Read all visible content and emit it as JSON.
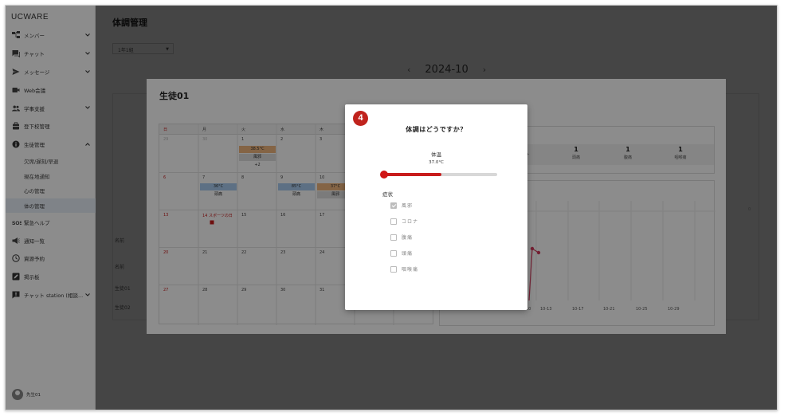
{
  "app": {
    "brand": "UCWARE"
  },
  "sidebar": {
    "items": [
      {
        "label": "メンバー",
        "icon": "org-chart-icon",
        "has_chevron": true
      },
      {
        "label": "チャット",
        "icon": "chat-icon",
        "has_chevron": true
      },
      {
        "label": "メッセージ",
        "icon": "send-icon",
        "has_chevron": true
      },
      {
        "label": "Web会議",
        "icon": "video-icon",
        "has_chevron": false
      },
      {
        "label": "学事支援",
        "icon": "people-icon",
        "has_chevron": true
      },
      {
        "label": "登下校管理",
        "icon": "briefcase-icon",
        "has_chevron": false
      },
      {
        "label": "生徒管理",
        "icon": "info-icon",
        "has_chevron": true
      }
    ],
    "subitems": [
      "欠席/遅刻/早退",
      "現在地通知",
      "心の管理",
      "体の管理"
    ],
    "items_after": [
      {
        "label": "緊急ヘルプ",
        "icon": "sos-icon"
      },
      {
        "label": "通知一覧",
        "icon": "megaphone-icon"
      },
      {
        "label": "資源予約",
        "icon": "clock-icon"
      },
      {
        "label": "掲示板",
        "icon": "edit-icon"
      },
      {
        "label": "チャット station (相談...",
        "icon": "chat-report-icon"
      }
    ],
    "user_name": "先生01"
  },
  "main": {
    "title": "体調管理",
    "grade_select": "1年1組",
    "month": "2024-10",
    "bg_rows": [
      "名前",
      "名前",
      "生徒01",
      "生徒02"
    ]
  },
  "student_card": {
    "title": "生徒01",
    "weekdays": [
      "日",
      "月",
      "火",
      "水",
      "木"
    ],
    "weeks": [
      [
        "29",
        "30",
        "1",
        "2",
        "3"
      ],
      [
        "6",
        "7",
        "8",
        "9",
        "10"
      ],
      [
        "13",
        "14 スポーツの日",
        "15",
        "16",
        "17"
      ],
      [
        "20",
        "21",
        "22",
        "23",
        "24"
      ],
      [
        "27",
        "28",
        "29",
        "30",
        "31"
      ]
    ],
    "tags": {
      "oct1_temp": "38.5°C",
      "oct1_sym": "風邪",
      "oct1_more": "+2",
      "oct7_temp": "36°C",
      "oct7_sym": "頭痛",
      "oct9_temp": "85°C",
      "oct9_sym": "頭痛",
      "oct10_temp": "37°C",
      "oct10_sym": "風邪"
    },
    "stats": [
      {
        "n": "1",
        "l": "頭痛"
      },
      {
        "n": "1",
        "l": "腹痛"
      },
      {
        "n": "1",
        "l": "咽喉痛"
      }
    ],
    "stat_partial": "ナ",
    "chart": {
      "x_ticks": [
        "10-13",
        "10-17",
        "10-21",
        "10-25",
        "10-29"
      ],
      "first_tick": "10",
      "y_tick": "0"
    }
  },
  "dialog": {
    "step": "4",
    "title": "体調はどうですか？",
    "temp_label": "体温",
    "temp_value": "37.0°C",
    "slider_fraction": 0.51,
    "symptoms_label": "症状",
    "symptoms": [
      {
        "label": "風邪",
        "checked": true
      },
      {
        "label": "コロナ",
        "checked": false
      },
      {
        "label": "腹痛",
        "checked": false
      },
      {
        "label": "頭痛",
        "checked": false
      },
      {
        "label": "咽喉痛",
        "checked": false
      }
    ],
    "colors": {
      "accent": "#c81c1c",
      "badge": "#c0231d"
    }
  }
}
